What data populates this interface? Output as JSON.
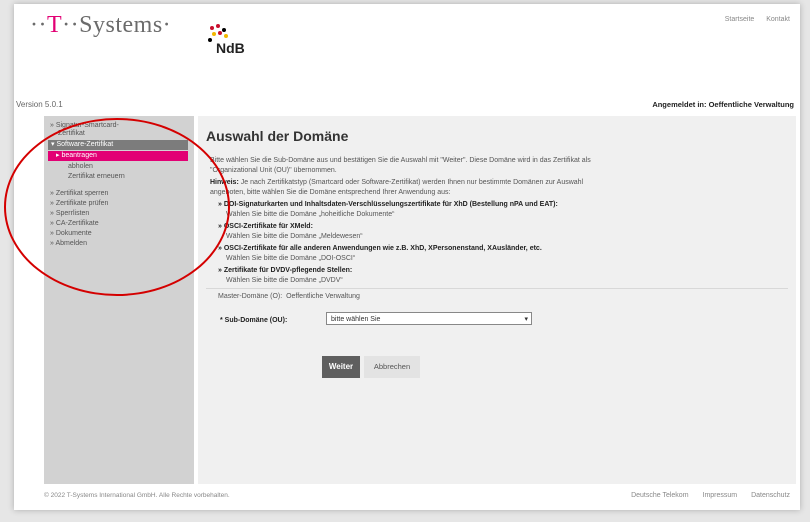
{
  "header": {
    "logo_prefix": "··",
    "logo_t": "T",
    "logo_suffix": "··Systems·",
    "ndb_label": "NdB",
    "nav": [
      "Startseite",
      "Kontakt"
    ]
  },
  "version": "Version 5.0.1",
  "logged_in": "Angemeldet in: Oeffentliche Verwaltung",
  "sidebar": {
    "items": [
      {
        "label": "» Signatur-Smartcard-"
      },
      {
        "label": "Zertifikat"
      },
      {
        "label": "▾ Software-Zertifikat"
      },
      {
        "label": "▸ beantragen"
      },
      {
        "label": "abholen"
      },
      {
        "label": "Zertifikat erneuern"
      },
      {
        "label": "» Zertifikat sperren"
      },
      {
        "label": "» Zertifikate prüfen"
      },
      {
        "label": "» Sperrlisten"
      },
      {
        "label": "» CA-Zertifikate"
      },
      {
        "label": "» Dokumente"
      },
      {
        "label": "» Abmelden"
      }
    ]
  },
  "main": {
    "title": "Auswahl der Domäne",
    "intro_line1": "Bitte wählen Sie die Sub-Domäne aus und bestätigen Sie die Auswahl mit \"Weiter\". Diese Domäne wird in das Zertifikat als",
    "intro_line2": "\"Organizational Unit (OU)\" übernommen.",
    "hint_label": "Hinweis:",
    "hint_line1": " Je nach Zertifikatstyp (Smartcard oder Software-Zertifikat) werden Ihnen nur bestimmte Domänen zur Auswahl",
    "hint_line2": "angeboten, bitte wählen Sie die Domäne entsprechend Ihrer Anwendung aus:",
    "options": [
      {
        "title": "DOI-Signaturkarten und Inhaltsdaten-Verschlüsselungszertifikate für XhD (Bestellung nPA und EAT):",
        "desc": "Wählen Sie bitte die Domäne „hoheitliche Dokumente“"
      },
      {
        "title": "OSCI-Zertifikate für XMeld:",
        "desc": "Wählen Sie bitte die Domäne „Meldewesen“"
      },
      {
        "title": "OSCI-Zertifikate für alle anderen Anwendungen wie z.B. XhD, XPersonenstand, XAusländer, etc.",
        "desc": "Wählen Sie bitte die Domäne „DOI-OSCI“"
      },
      {
        "title": "Zertifikate für DVDV-pflegende Stellen:",
        "desc": "Wählen Sie bitte die Domäne „DVDV“"
      }
    ],
    "master_domain_label": "Master-Domäne (O):",
    "master_domain_value": "Oeffentliche Verwaltung",
    "subdomain_label": "* Sub-Domäne (OU):",
    "subdomain_value": "bitte wählen Sie",
    "btn_next": "Weiter",
    "btn_cancel": "Abbrechen"
  },
  "footer": {
    "copyright": "© 2022 T-Systems International GmbH. Alle Rechte vorbehalten.",
    "links": [
      "Deutsche Telekom",
      "Impressum",
      "Datenschutz"
    ]
  },
  "colors": {
    "accent": "#e20074",
    "annotation": "#d40000"
  }
}
